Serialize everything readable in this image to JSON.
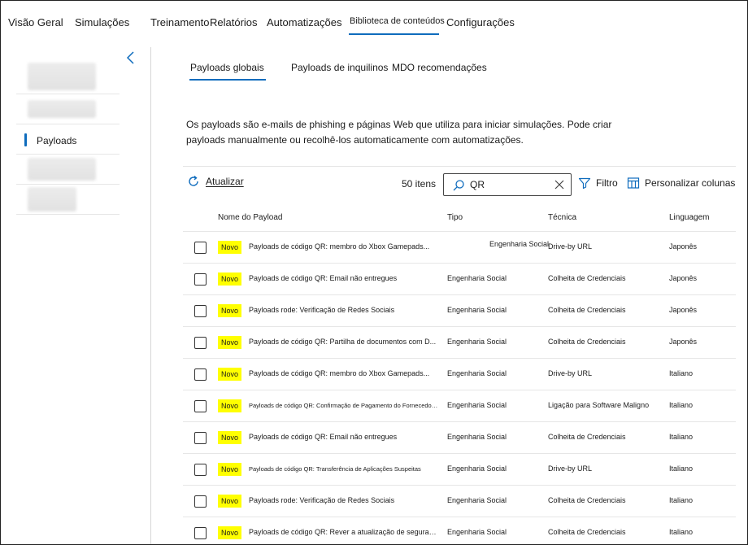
{
  "topnav": [
    {
      "label": "Visão Geral",
      "active": false
    },
    {
      "label": "Simulações",
      "active": false
    },
    {
      "label": "Treinamento",
      "active": false
    },
    {
      "label": "Relatórios",
      "active": false
    },
    {
      "label": "Automatizações",
      "active": false
    },
    {
      "label": "Biblioteca de conteúdos",
      "active": true
    },
    {
      "label": "Configurações",
      "active": false
    }
  ],
  "sidebar": {
    "active_label": "Payloads",
    "collapse_icon": "chevron-left-icon"
  },
  "subtabs": [
    {
      "label": "Payloads globais",
      "active": true
    },
    {
      "label": "Payloads de inquilinos",
      "active": false
    },
    {
      "label": "MDO recomendações",
      "active": false
    }
  ],
  "description": "Os payloads são e-mails de phishing e páginas Web que utiliza para iniciar simulações. Pode criar payloads manualmente ou recolhê-los automaticamente com automatizações.",
  "toolbar": {
    "refresh_label": "Atualizar",
    "count": "50 itens",
    "search_value": "QR",
    "filter_label": "Filtro",
    "customize_label": "Personalizar colunas"
  },
  "table": {
    "headers": {
      "name": "Nome do Payload",
      "tipo": "Tipo",
      "tecnica": "Técnica",
      "linguagem": "Linguagem"
    },
    "badge": "Novo",
    "rows": [
      {
        "name": "Payloads de código QR: membro do Xbox Gamepads...",
        "tipo": "Engenharia Social",
        "tecnica": "Drive-by URL",
        "linguagem": "Japonês"
      },
      {
        "name": "Payloads de código QR: Email não entregues",
        "tipo": "Engenharia Social",
        "tecnica": "Colheita de Credenciais",
        "linguagem": "Japonês"
      },
      {
        "name": "Payloads rode: Verificação de Redes Sociais",
        "tipo": "Engenharia Social",
        "tecnica": "Colheita de Credenciais",
        "linguagem": "Japonês"
      },
      {
        "name": "Payloads de código QR: Partilha de documentos com D...",
        "tipo": "Engenharia Social",
        "tecnica": "Colheita de Credenciais",
        "linguagem": "Japonês"
      },
      {
        "name": "Payloads de código QR: membro do Xbox Gamepads...",
        "tipo": "Engenharia Social",
        "tecnica": "Drive-by URL",
        "linguagem": "Italiano"
      },
      {
        "name": "Payloads de código QR: Confirmação de Pagamento do Fornecedor...",
        "tipo": "Engenharia Social",
        "tecnica": "Ligação para Software Maligno",
        "linguagem": "Italiano"
      },
      {
        "name": "Payloads de código QR: Email não entregues",
        "tipo": "Engenharia Social",
        "tecnica": "Colheita de Credenciais",
        "linguagem": "Italiano"
      },
      {
        "name": "Payloads de código QR: Transferência de Aplicações Suspeitas",
        "tipo": "Engenharia Social",
        "tecnica": "Drive-by URL",
        "linguagem": "Italiano"
      },
      {
        "name": "Payloads rode: Verificação de Redes Sociais",
        "tipo": "Engenharia Social",
        "tecnica": "Colheita de Credenciais",
        "linguagem": "Italiano"
      },
      {
        "name": "Payloads de código QR: Rever a atualização de segurança",
        "tipo": "Engenharia Social",
        "tecnica": "Colheita de Credenciais",
        "linguagem": "Italiano"
      }
    ]
  },
  "colors": {
    "accent": "#0f6cbd",
    "badge": "#ffff00"
  }
}
